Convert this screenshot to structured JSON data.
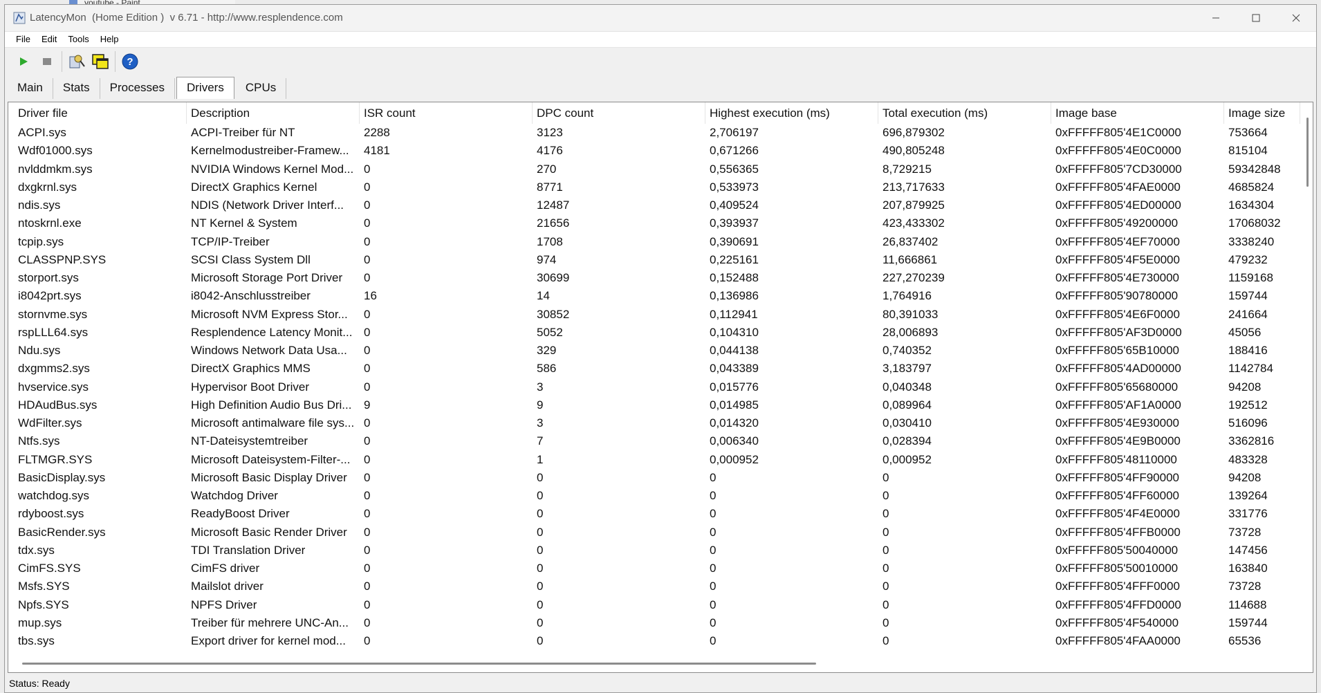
{
  "background_window": {
    "title": "youtube - Paint"
  },
  "window": {
    "title": "LatencyMon  (Home Edition )  v 6.71 - http://www.resplendence.com",
    "controls": [
      "minimize-icon",
      "maximize-icon",
      "close-icon"
    ]
  },
  "menu": [
    "File",
    "Edit",
    "Tools",
    "Help"
  ],
  "toolbar": {
    "buttons": [
      "play-icon",
      "stop-icon",
      "driver-report-icon",
      "windows-icon",
      "help-icon"
    ],
    "colors": {
      "play": "#2eaa2e",
      "stop": "#8a8a8a",
      "help": "#1f5fc4",
      "highlight": "#f2e61a"
    }
  },
  "tabs": [
    "Main",
    "Stats",
    "Processes",
    "Drivers",
    "CPUs"
  ],
  "active_tab": "Drivers",
  "table": {
    "columns": [
      "Driver file",
      "Description",
      "ISR count",
      "DPC count",
      "Highest execution (ms)",
      "Total execution (ms)",
      "Image base",
      "Image size"
    ],
    "rows": [
      [
        "ACPI.sys",
        "ACPI-Treiber für NT",
        "2288",
        "3123",
        "2,706197",
        "696,879302",
        "0xFFFFF805'4E1C0000",
        "753664"
      ],
      [
        "Wdf01000.sys",
        "Kernelmodustreiber-Framew...",
        "4181",
        "4176",
        "0,671266",
        "490,805248",
        "0xFFFFF805'4E0C0000",
        "815104"
      ],
      [
        "nvlddmkm.sys",
        "NVIDIA Windows Kernel Mod...",
        "0",
        "270",
        "0,556365",
        "8,729215",
        "0xFFFFF805'7CD30000",
        "59342848"
      ],
      [
        "dxgkrnl.sys",
        "DirectX Graphics Kernel",
        "0",
        "8771",
        "0,533973",
        "213,717633",
        "0xFFFFF805'4FAE0000",
        "4685824"
      ],
      [
        "ndis.sys",
        "NDIS (Network Driver Interf...",
        "0",
        "12487",
        "0,409524",
        "207,879925",
        "0xFFFFF805'4ED00000",
        "1634304"
      ],
      [
        "ntoskrnl.exe",
        "NT Kernel & System",
        "0",
        "21656",
        "0,393937",
        "423,433302",
        "0xFFFFF805'49200000",
        "17068032"
      ],
      [
        "tcpip.sys",
        "TCP/IP-Treiber",
        "0",
        "1708",
        "0,390691",
        "26,837402",
        "0xFFFFF805'4EF70000",
        "3338240"
      ],
      [
        "CLASSPNP.SYS",
        "SCSI Class System Dll",
        "0",
        "974",
        "0,225161",
        "11,666861",
        "0xFFFFF805'4F5E0000",
        "479232"
      ],
      [
        "storport.sys",
        "Microsoft Storage Port Driver",
        "0",
        "30699",
        "0,152488",
        "227,270239",
        "0xFFFFF805'4E730000",
        "1159168"
      ],
      [
        "i8042prt.sys",
        "i8042-Anschlusstreiber",
        "16",
        "14",
        "0,136986",
        "1,764916",
        "0xFFFFF805'90780000",
        "159744"
      ],
      [
        "stornvme.sys",
        "Microsoft NVM Express Stor...",
        "0",
        "30852",
        "0,112941",
        "80,391033",
        "0xFFFFF805'4E6F0000",
        "241664"
      ],
      [
        "rspLLL64.sys",
        "Resplendence Latency Monit...",
        "0",
        "5052",
        "0,104310",
        "28,006893",
        "0xFFFFF805'AF3D0000",
        "45056"
      ],
      [
        "Ndu.sys",
        "Windows Network Data Usa...",
        "0",
        "329",
        "0,044138",
        "0,740352",
        "0xFFFFF805'65B10000",
        "188416"
      ],
      [
        "dxgmms2.sys",
        "DirectX Graphics MMS",
        "0",
        "586",
        "0,043389",
        "3,183797",
        "0xFFFFF805'4AD00000",
        "1142784"
      ],
      [
        "hvservice.sys",
        "Hypervisor Boot Driver",
        "0",
        "3",
        "0,015776",
        "0,040348",
        "0xFFFFF805'65680000",
        "94208"
      ],
      [
        "HDAudBus.sys",
        "High Definition Audio Bus Dri...",
        "9",
        "9",
        "0,014985",
        "0,089964",
        "0xFFFFF805'AF1A0000",
        "192512"
      ],
      [
        "WdFilter.sys",
        "Microsoft antimalware file sys...",
        "0",
        "3",
        "0,014320",
        "0,030410",
        "0xFFFFF805'4E930000",
        "516096"
      ],
      [
        "Ntfs.sys",
        "NT-Dateisystemtreiber",
        "0",
        "7",
        "0,006340",
        "0,028394",
        "0xFFFFF805'4E9B0000",
        "3362816"
      ],
      [
        "FLTMGR.SYS",
        "Microsoft Dateisystem-Filter-...",
        "0",
        "1",
        "0,000952",
        "0,000952",
        "0xFFFFF805'48110000",
        "483328"
      ],
      [
        "BasicDisplay.sys",
        "Microsoft Basic Display Driver",
        "0",
        "0",
        "0",
        "0",
        "0xFFFFF805'4FF90000",
        "94208"
      ],
      [
        "watchdog.sys",
        "Watchdog Driver",
        "0",
        "0",
        "0",
        "0",
        "0xFFFFF805'4FF60000",
        "139264"
      ],
      [
        "rdyboost.sys",
        "ReadyBoost Driver",
        "0",
        "0",
        "0",
        "0",
        "0xFFFFF805'4F4E0000",
        "331776"
      ],
      [
        "BasicRender.sys",
        "Microsoft Basic Render Driver",
        "0",
        "0",
        "0",
        "0",
        "0xFFFFF805'4FFB0000",
        "73728"
      ],
      [
        "tdx.sys",
        "TDI Translation Driver",
        "0",
        "0",
        "0",
        "0",
        "0xFFFFF805'50040000",
        "147456"
      ],
      [
        "CimFS.SYS",
        "CimFS driver",
        "0",
        "0",
        "0",
        "0",
        "0xFFFFF805'50010000",
        "163840"
      ],
      [
        "Msfs.SYS",
        "Mailslot driver",
        "0",
        "0",
        "0",
        "0",
        "0xFFFFF805'4FFF0000",
        "73728"
      ],
      [
        "Npfs.SYS",
        "NPFS Driver",
        "0",
        "0",
        "0",
        "0",
        "0xFFFFF805'4FFD0000",
        "114688"
      ],
      [
        "mup.sys",
        "Treiber für mehrere UNC-An...",
        "0",
        "0",
        "0",
        "0",
        "0xFFFFF805'4F540000",
        "159744"
      ],
      [
        "tbs.sys",
        "Export driver for kernel mod...",
        "0",
        "0",
        "0",
        "0",
        "0xFFFFF805'4FAA0000",
        "65536"
      ]
    ]
  },
  "status": "Status: Ready"
}
